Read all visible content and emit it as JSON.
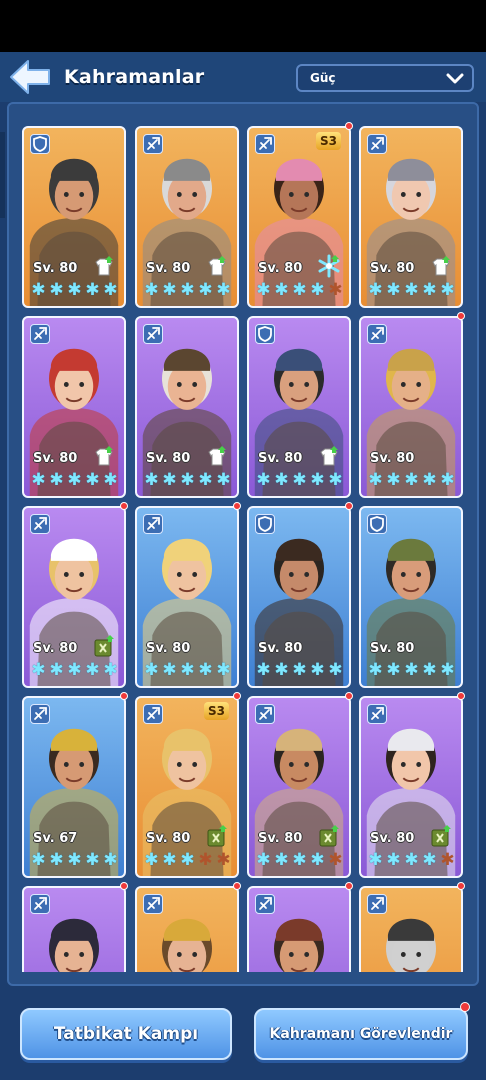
{
  "header": {
    "title": "Kahramanlar",
    "sort_label": "Güç"
  },
  "buttons": {
    "training": "Tatbikat Kampı",
    "assign": "Kahramanı Görevlendir"
  },
  "heroes": [
    {
      "level": "Sv. 80",
      "stars_on": 5,
      "stars_total": 5,
      "bg": "orange",
      "class": "shield",
      "badge": "outfit",
      "skin": "#d69a74",
      "hat": "#3b3b3b",
      "hair": "#3b3b3b"
    },
    {
      "level": "Sv. 80",
      "stars_on": 5,
      "stars_total": 5,
      "bg": "orange",
      "class": "bow",
      "badge": "outfit",
      "skin": "#e2a98a",
      "hat": "#8a8a8a",
      "hair": "#d9d9d9"
    },
    {
      "level": "Sv. 80",
      "stars_on": 4,
      "stars_total": 5,
      "bg": "orange",
      "class": "bow",
      "badge": "snowflake",
      "sbadge": "S3",
      "dot": true,
      "skin": "#b57658",
      "hat": "#e38bb0",
      "hair": "#3a2418"
    },
    {
      "level": "Sv. 80",
      "stars_on": 5,
      "stars_total": 5,
      "bg": "orange",
      "class": "bow",
      "badge": "outfit",
      "skin": "#f0c8b0",
      "hat": "#8e8e9a",
      "hair": "#d6d6dd"
    },
    {
      "level": "Sv. 80",
      "stars_on": 5,
      "stars_total": 5,
      "bg": "purple",
      "class": "bow",
      "badge": "outfit",
      "skin": "#f1c6aa",
      "hat": "#c43a31",
      "hair": "#c43a31"
    },
    {
      "level": "Sv. 80",
      "stars_on": 5,
      "stars_total": 5,
      "bg": "purple",
      "class": "bow",
      "badge": "outfit",
      "skin": "#eab493",
      "hat": "#5b4630",
      "hair": "#e7e2d8"
    },
    {
      "level": "Sv. 80",
      "stars_on": 5,
      "stars_total": 5,
      "bg": "purple",
      "class": "shield",
      "badge": "outfit",
      "skin": "#d9a07e",
      "hat": "#3a4f78",
      "hair": "#2b2b2b"
    },
    {
      "level": "Sv. 80",
      "stars_on": 5,
      "stars_total": 5,
      "bg": "purple",
      "class": "bow",
      "dot": true,
      "skin": "#e5b088",
      "hat": "#c9a24a",
      "hair": "#e0b64b"
    },
    {
      "level": "Sv. 80",
      "stars_on": 5,
      "stars_total": 5,
      "bg": "purple",
      "class": "bow",
      "badge": "manual",
      "dot": true,
      "skin": "#efc3a0",
      "hat": "#ffffff",
      "hair": "#e8c26a"
    },
    {
      "level": "Sv. 80",
      "stars_on": 5,
      "stars_total": 5,
      "bg": "blue",
      "class": "bow",
      "dot": true,
      "skin": "#efc3a0",
      "hat": "#f0d27a",
      "hair": "#f0d27a"
    },
    {
      "level": "Sv. 80",
      "stars_on": 5,
      "stars_total": 5,
      "bg": "blue",
      "class": "shield",
      "dot": true,
      "skin": "#c58a6a",
      "hat": "#3b2a20",
      "hair": "#2b2520"
    },
    {
      "level": "Sv. 80",
      "stars_on": 5,
      "stars_total": 5,
      "bg": "blue",
      "class": "shield",
      "skin": "#d89c7a",
      "hat": "#6b7a3d",
      "hair": "#2e2a26"
    },
    {
      "level": "Sv. 67",
      "stars_on": 5,
      "stars_total": 5,
      "bg": "blue",
      "class": "bow",
      "dot": true,
      "skin": "#d69a74",
      "hat": "#d8b23a",
      "hair": "#3a2a20"
    },
    {
      "level": "Sv. 80",
      "stars_on": 3,
      "stars_total": 5,
      "bg": "orange",
      "class": "bow",
      "badge": "manual",
      "sbadge": "S3",
      "dot": true,
      "skin": "#efc3a0",
      "hat": "#e8c26a",
      "hair": "#e8c26a"
    },
    {
      "level": "Sv. 80",
      "stars_on": 4,
      "stars_total": 5,
      "bg": "purple",
      "class": "bow",
      "badge": "manual",
      "dot": true,
      "skin": "#c88a62",
      "hat": "#d6b37a",
      "hair": "#2b2520"
    },
    {
      "level": "Sv. 80",
      "stars_on": 4,
      "stars_total": 5,
      "bg": "purple",
      "class": "bow",
      "badge": "manual",
      "dot": true,
      "skin": "#f1c6aa",
      "hat": "#e9e9ee",
      "hair": "#2e2420"
    },
    {
      "level": "",
      "stars_on": 0,
      "stars_total": 0,
      "bg": "purple",
      "class": "bow",
      "dot": true,
      "skin": "#e6b393",
      "hat": "#2c2a3a",
      "hair": "#2c2a3a"
    },
    {
      "level": "",
      "stars_on": 0,
      "stars_total": 0,
      "bg": "orange",
      "class": "bow",
      "dot": true,
      "skin": "#e6b393",
      "hat": "#d8a93a",
      "hair": "#6a4a2a"
    },
    {
      "level": "",
      "stars_on": 0,
      "stars_total": 0,
      "bg": "purple",
      "class": "bow",
      "dot": true,
      "skin": "#d69a74",
      "hat": "#7a3a2a",
      "hair": "#3a2a20"
    },
    {
      "level": "",
      "stars_on": 0,
      "stars_total": 0,
      "bg": "orange",
      "class": "bow",
      "dot": true,
      "skin": "#d0d0d0",
      "hat": "#3a3a3a",
      "hair": "#cfcfcf"
    }
  ],
  "colors": {
    "star_on": "#7fe8ff",
    "star_off": "#b0542c",
    "notification_dot": "#f03a3a"
  }
}
